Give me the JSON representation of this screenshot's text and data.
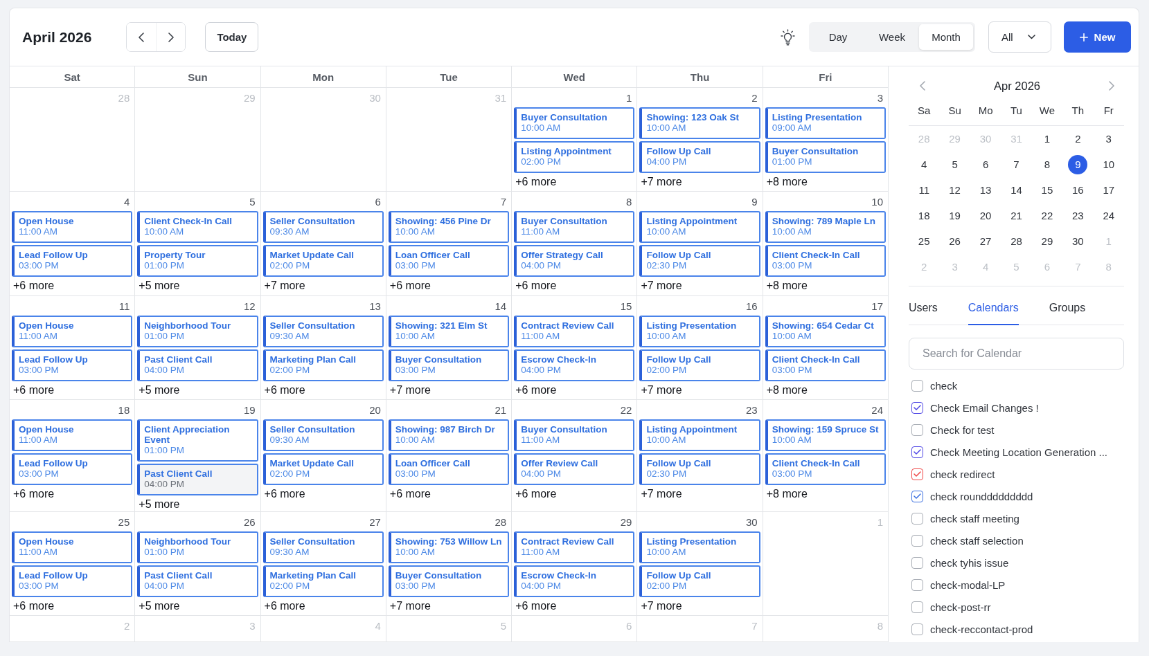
{
  "header": {
    "title": "April 2026",
    "today": "Today",
    "views": [
      {
        "label": "Day",
        "selected": false
      },
      {
        "label": "Week",
        "selected": false
      },
      {
        "label": "Month",
        "selected": true
      }
    ],
    "filter": "All",
    "new_button": "New"
  },
  "calendar": {
    "weekdays": [
      "Sat",
      "Sun",
      "Mon",
      "Tue",
      "Wed",
      "Thu",
      "Fri"
    ],
    "weeks": [
      {
        "days": [
          {
            "date": "28",
            "in_month": false
          },
          {
            "date": "29",
            "in_month": false
          },
          {
            "date": "30",
            "in_month": false
          },
          {
            "date": "31",
            "in_month": false
          },
          {
            "date": "1",
            "in_month": true,
            "events": [
              {
                "title": "Buyer Consultation",
                "time": "10:00 AM",
                "hovered": false
              },
              {
                "title": "Listing Appointment",
                "time": "02:00 PM",
                "hovered": false
              }
            ],
            "more": "+6 more"
          },
          {
            "date": "2",
            "in_month": true,
            "events": [
              {
                "title": "Showing: 123 Oak St",
                "time": "10:00 AM",
                "hovered": false
              },
              {
                "title": "Follow Up Call",
                "time": "04:00 PM",
                "hovered": false
              }
            ],
            "more": "+7 more"
          },
          {
            "date": "3",
            "in_month": true,
            "events": [
              {
                "title": "Listing Presentation",
                "time": "09:00 AM",
                "hovered": false
              },
              {
                "title": "Buyer Consultation",
                "time": "01:00 PM",
                "hovered": false
              }
            ],
            "more": "+8 more"
          }
        ]
      },
      {
        "days": [
          {
            "date": "4",
            "in_month": true,
            "events": [
              {
                "title": "Open House",
                "time": "11:00 AM",
                "hovered": false
              },
              {
                "title": "Lead Follow Up",
                "time": "03:00 PM",
                "hovered": false
              }
            ],
            "more": "+6 more"
          },
          {
            "date": "5",
            "in_month": true,
            "events": [
              {
                "title": "Client Check-In Call",
                "time": "10:00 AM",
                "hovered": false
              },
              {
                "title": "Property Tour",
                "time": "01:00 PM",
                "hovered": false
              }
            ],
            "more": "+5 more"
          },
          {
            "date": "6",
            "in_month": true,
            "events": [
              {
                "title": "Seller Consultation",
                "time": "09:30 AM",
                "hovered": false
              },
              {
                "title": "Market Update Call",
                "time": "02:00 PM",
                "hovered": false
              }
            ],
            "more": "+7 more"
          },
          {
            "date": "7",
            "in_month": true,
            "events": [
              {
                "title": "Showing: 456 Pine Dr",
                "time": "10:00 AM",
                "hovered": false
              },
              {
                "title": "Loan Officer Call",
                "time": "03:00 PM",
                "hovered": false
              }
            ],
            "more": "+6 more"
          },
          {
            "date": "8",
            "in_month": true,
            "events": [
              {
                "title": "Buyer Consultation",
                "time": "11:00 AM",
                "hovered": false
              },
              {
                "title": "Offer Strategy Call",
                "time": "04:00 PM",
                "hovered": false
              }
            ],
            "more": "+6 more"
          },
          {
            "date": "9",
            "in_month": true,
            "events": [
              {
                "title": "Listing Appointment",
                "time": "10:00 AM",
                "hovered": false
              },
              {
                "title": "Follow Up Call",
                "time": "02:30 PM",
                "hovered": false
              }
            ],
            "more": "+7 more"
          },
          {
            "date": "10",
            "in_month": true,
            "events": [
              {
                "title": "Showing: 789 Maple Ln",
                "time": "10:00 AM",
                "hovered": false
              },
              {
                "title": "Client Check-In Call",
                "time": "03:00 PM",
                "hovered": false
              }
            ],
            "more": "+8 more"
          }
        ]
      },
      {
        "days": [
          {
            "date": "11",
            "in_month": true,
            "events": [
              {
                "title": "Open House",
                "time": "11:00 AM",
                "hovered": false
              },
              {
                "title": "Lead Follow Up",
                "time": "03:00 PM",
                "hovered": false
              }
            ],
            "more": "+6 more"
          },
          {
            "date": "12",
            "in_month": true,
            "events": [
              {
                "title": "Neighborhood Tour",
                "time": "01:00 PM",
                "hovered": false
              },
              {
                "title": "Past Client Call",
                "time": "04:00 PM",
                "hovered": false
              }
            ],
            "more": "+5 more"
          },
          {
            "date": "13",
            "in_month": true,
            "events": [
              {
                "title": "Seller Consultation",
                "time": "09:30 AM",
                "hovered": false
              },
              {
                "title": "Marketing Plan Call",
                "time": "02:00 PM",
                "hovered": false
              }
            ],
            "more": "+6 more"
          },
          {
            "date": "14",
            "in_month": true,
            "events": [
              {
                "title": "Showing: 321 Elm St",
                "time": "10:00 AM",
                "hovered": false
              },
              {
                "title": "Buyer Consultation",
                "time": "03:00 PM",
                "hovered": false
              }
            ],
            "more": "+7 more"
          },
          {
            "date": "15",
            "in_month": true,
            "events": [
              {
                "title": "Contract Review Call",
                "time": "11:00 AM",
                "hovered": false
              },
              {
                "title": "Escrow Check-In",
                "time": "04:00 PM",
                "hovered": false
              }
            ],
            "more": "+6 more"
          },
          {
            "date": "16",
            "in_month": true,
            "events": [
              {
                "title": "Listing Presentation",
                "time": "10:00 AM",
                "hovered": false
              },
              {
                "title": "Follow Up Call",
                "time": "02:00 PM",
                "hovered": false
              }
            ],
            "more": "+7 more"
          },
          {
            "date": "17",
            "in_month": true,
            "events": [
              {
                "title": "Showing: 654 Cedar Ct",
                "time": "10:00 AM",
                "hovered": false
              },
              {
                "title": "Client Check-In Call",
                "time": "03:00 PM",
                "hovered": false
              }
            ],
            "more": "+8 more"
          }
        ]
      },
      {
        "days": [
          {
            "date": "18",
            "in_month": true,
            "events": [
              {
                "title": "Open House",
                "time": "11:00 AM",
                "hovered": false
              },
              {
                "title": "Lead Follow Up",
                "time": "03:00 PM",
                "hovered": false
              }
            ],
            "more": "+6 more"
          },
          {
            "date": "19",
            "in_month": true,
            "events": [
              {
                "title": "Client Appreciation Event",
                "time": "01:00 PM",
                "hovered": false
              },
              {
                "title": "Past Client Call",
                "time": "04:00 PM",
                "hovered": true
              }
            ],
            "more": "+5 more"
          },
          {
            "date": "20",
            "in_month": true,
            "events": [
              {
                "title": "Seller Consultation",
                "time": "09:30 AM",
                "hovered": false
              },
              {
                "title": "Market Update Call",
                "time": "02:00 PM",
                "hovered": false
              }
            ],
            "more": "+6 more"
          },
          {
            "date": "21",
            "in_month": true,
            "events": [
              {
                "title": "Showing: 987 Birch Dr",
                "time": "10:00 AM",
                "hovered": false
              },
              {
                "title": "Loan Officer Call",
                "time": "03:00 PM",
                "hovered": false
              }
            ],
            "more": "+6 more"
          },
          {
            "date": "22",
            "in_month": true,
            "events": [
              {
                "title": "Buyer Consultation",
                "time": "11:00 AM",
                "hovered": false
              },
              {
                "title": "Offer Review Call",
                "time": "04:00 PM",
                "hovered": false
              }
            ],
            "more": "+6 more"
          },
          {
            "date": "23",
            "in_month": true,
            "events": [
              {
                "title": "Listing Appointment",
                "time": "10:00 AM",
                "hovered": false
              },
              {
                "title": "Follow Up Call",
                "time": "02:30 PM",
                "hovered": false
              }
            ],
            "more": "+7 more"
          },
          {
            "date": "24",
            "in_month": true,
            "events": [
              {
                "title": "Showing: 159 Spruce St",
                "time": "10:00 AM",
                "hovered": false
              },
              {
                "title": "Client Check-In Call",
                "time": "03:00 PM",
                "hovered": false
              }
            ],
            "more": "+8 more"
          }
        ]
      },
      {
        "days": [
          {
            "date": "25",
            "in_month": true,
            "events": [
              {
                "title": "Open House",
                "time": "11:00 AM",
                "hovered": false
              },
              {
                "title": "Lead Follow Up",
                "time": "03:00 PM",
                "hovered": false
              }
            ],
            "more": "+6 more"
          },
          {
            "date": "26",
            "in_month": true,
            "events": [
              {
                "title": "Neighborhood Tour",
                "time": "01:00 PM",
                "hovered": false
              },
              {
                "title": "Past Client Call",
                "time": "04:00 PM",
                "hovered": false
              }
            ],
            "more": "+5 more"
          },
          {
            "date": "27",
            "in_month": true,
            "events": [
              {
                "title": "Seller Consultation",
                "time": "09:30 AM",
                "hovered": false
              },
              {
                "title": "Marketing Plan Call",
                "time": "02:00 PM",
                "hovered": false
              }
            ],
            "more": "+6 more"
          },
          {
            "date": "28",
            "in_month": true,
            "events": [
              {
                "title": "Showing: 753 Willow Ln",
                "time": "10:00 AM",
                "hovered": false
              },
              {
                "title": "Buyer Consultation",
                "time": "03:00 PM",
                "hovered": false
              }
            ],
            "more": "+7 more"
          },
          {
            "date": "29",
            "in_month": true,
            "events": [
              {
                "title": "Contract Review Call",
                "time": "11:00 AM",
                "hovered": false
              },
              {
                "title": "Escrow Check-In",
                "time": "04:00 PM",
                "hovered": false
              }
            ],
            "more": "+6 more"
          },
          {
            "date": "30",
            "in_month": true,
            "events": [
              {
                "title": "Listing Presentation",
                "time": "10:00 AM",
                "hovered": false
              },
              {
                "title": "Follow Up Call",
                "time": "02:00 PM",
                "hovered": false
              }
            ],
            "more": "+7 more"
          },
          {
            "date": "1",
            "in_month": false
          }
        ]
      },
      {
        "days": [
          {
            "date": "2",
            "in_month": false
          },
          {
            "date": "3",
            "in_month": false
          },
          {
            "date": "4",
            "in_month": false
          },
          {
            "date": "5",
            "in_month": false
          },
          {
            "date": "6",
            "in_month": false
          },
          {
            "date": "7",
            "in_month": false
          },
          {
            "date": "8",
            "in_month": false
          }
        ]
      }
    ]
  },
  "sidebar": {
    "mini_calendar": {
      "title": "Apr 2026",
      "weekdays": [
        "Sa",
        "Su",
        "Mo",
        "Tu",
        "We",
        "Th",
        "Fr"
      ],
      "weeks": [
        {
          "days": [
            {
              "date": "28",
              "in_month": false,
              "selected": false
            },
            {
              "date": "29",
              "in_month": false,
              "selected": false
            },
            {
              "date": "30",
              "in_month": false,
              "selected": false
            },
            {
              "date": "31",
              "in_month": false,
              "selected": false
            },
            {
              "date": "1",
              "in_month": true,
              "selected": false
            },
            {
              "date": "2",
              "in_month": true,
              "selected": false
            },
            {
              "date": "3",
              "in_month": true,
              "selected": false
            }
          ]
        },
        {
          "days": [
            {
              "date": "4",
              "in_month": true,
              "selected": false
            },
            {
              "date": "5",
              "in_month": true,
              "selected": false
            },
            {
              "date": "6",
              "in_month": true,
              "selected": false
            },
            {
              "date": "7",
              "in_month": true,
              "selected": false
            },
            {
              "date": "8",
              "in_month": true,
              "selected": false
            },
            {
              "date": "9",
              "in_month": true,
              "selected": true
            },
            {
              "date": "10",
              "in_month": true,
              "selected": false
            }
          ]
        },
        {
          "days": [
            {
              "date": "11",
              "in_month": true,
              "selected": false
            },
            {
              "date": "12",
              "in_month": true,
              "selected": false
            },
            {
              "date": "13",
              "in_month": true,
              "selected": false
            },
            {
              "date": "14",
              "in_month": true,
              "selected": false
            },
            {
              "date": "15",
              "in_month": true,
              "selected": false
            },
            {
              "date": "16",
              "in_month": true,
              "selected": false
            },
            {
              "date": "17",
              "in_month": true,
              "selected": false
            }
          ]
        },
        {
          "days": [
            {
              "date": "18",
              "in_month": true,
              "selected": false
            },
            {
              "date": "19",
              "in_month": true,
              "selected": false
            },
            {
              "date": "20",
              "in_month": true,
              "selected": false
            },
            {
              "date": "21",
              "in_month": true,
              "selected": false
            },
            {
              "date": "22",
              "in_month": true,
              "selected": false
            },
            {
              "date": "23",
              "in_month": true,
              "selected": false
            },
            {
              "date": "24",
              "in_month": true,
              "selected": false
            }
          ]
        },
        {
          "days": [
            {
              "date": "25",
              "in_month": true,
              "selected": false
            },
            {
              "date": "26",
              "in_month": true,
              "selected": false
            },
            {
              "date": "27",
              "in_month": true,
              "selected": false
            },
            {
              "date": "28",
              "in_month": true,
              "selected": false
            },
            {
              "date": "29",
              "in_month": true,
              "selected": false
            },
            {
              "date": "30",
              "in_month": true,
              "selected": false
            },
            {
              "date": "1",
              "in_month": false,
              "selected": false
            }
          ]
        },
        {
          "days": [
            {
              "date": "2",
              "in_month": false,
              "selected": false
            },
            {
              "date": "3",
              "in_month": false,
              "selected": false
            },
            {
              "date": "4",
              "in_month": false,
              "selected": false
            },
            {
              "date": "5",
              "in_month": false,
              "selected": false
            },
            {
              "date": "6",
              "in_month": false,
              "selected": false
            },
            {
              "date": "7",
              "in_month": false,
              "selected": false
            },
            {
              "date": "8",
              "in_month": false,
              "selected": false
            }
          ]
        }
      ]
    },
    "tabs": [
      {
        "label": "Users",
        "selected": false
      },
      {
        "label": "Calendars",
        "selected": true
      },
      {
        "label": "Groups",
        "selected": false
      }
    ],
    "search": {
      "placeholder": "Search for Calendar"
    },
    "calendars": [
      {
        "label": "check",
        "checked": false
      },
      {
        "label": "Check Email Changes !",
        "checked": true,
        "color": "#4f46e5"
      },
      {
        "label": "Check for test",
        "checked": false
      },
      {
        "label": "Check Meeting Location Generation ...",
        "checked": true,
        "color": "#4f46e5"
      },
      {
        "label": "check redirect",
        "checked": true,
        "color": "#ef4444"
      },
      {
        "label": "check rounddddddddd",
        "checked": true,
        "color": "#3b6fe0"
      },
      {
        "label": "check staff meeting",
        "checked": false
      },
      {
        "label": "check staff selection",
        "checked": false
      },
      {
        "label": "check tyhis issue",
        "checked": false
      },
      {
        "label": "check-modal-LP",
        "checked": false
      },
      {
        "label": "check-post-rr",
        "checked": false
      },
      {
        "label": "check-reccontact-prod",
        "checked": false
      }
    ]
  }
}
